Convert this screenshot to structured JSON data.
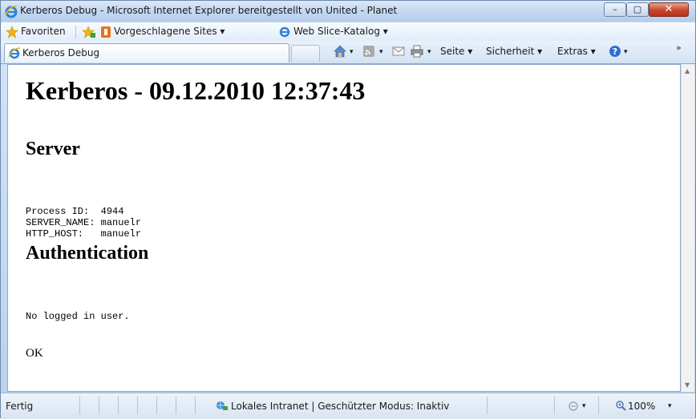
{
  "window": {
    "title": "Kerberos Debug - Microsoft Internet Explorer bereitgestellt von United - Planet",
    "minimize_glyph": "–",
    "maximize_glyph": "▢",
    "close_glyph": "✕"
  },
  "favorites_bar": {
    "favorites_label": "Favoriten",
    "suggested_sites_label": "Vorgeschlagene Sites ▾",
    "web_slice_label": "Web Slice-Katalog ▾"
  },
  "tab": {
    "label": "Kerberos Debug"
  },
  "command_bar": {
    "home_arrow": "▾",
    "feeds_arrow": "▾",
    "print_arrow": "▾",
    "page_label": "Seite ▾",
    "safety_label": "Sicherheit ▾",
    "tools_label": "Extras ▾",
    "help_arrow": "▾",
    "overflow": "»"
  },
  "page": {
    "heading": "Kerberos - 09.12.2010 12:37:43",
    "server_heading": "Server",
    "server_lines": "Process ID:  4944\nSERVER_NAME: manuelr\nHTTP_HOST:   manuelr",
    "auth_heading": "Authentication",
    "auth_text": "No logged in user.",
    "ok_text": "OK"
  },
  "status_bar": {
    "status": "Fertig",
    "zone": "Lokales Intranet | Geschützter Modus: Inaktiv",
    "zoom": "100%",
    "zoom_arrow": "▾",
    "protected_arrow": "▾"
  },
  "colors": {
    "title_bar": "#c3d8f1",
    "close_button": "#c9452b",
    "ie_icon": "#2f7fd6"
  }
}
